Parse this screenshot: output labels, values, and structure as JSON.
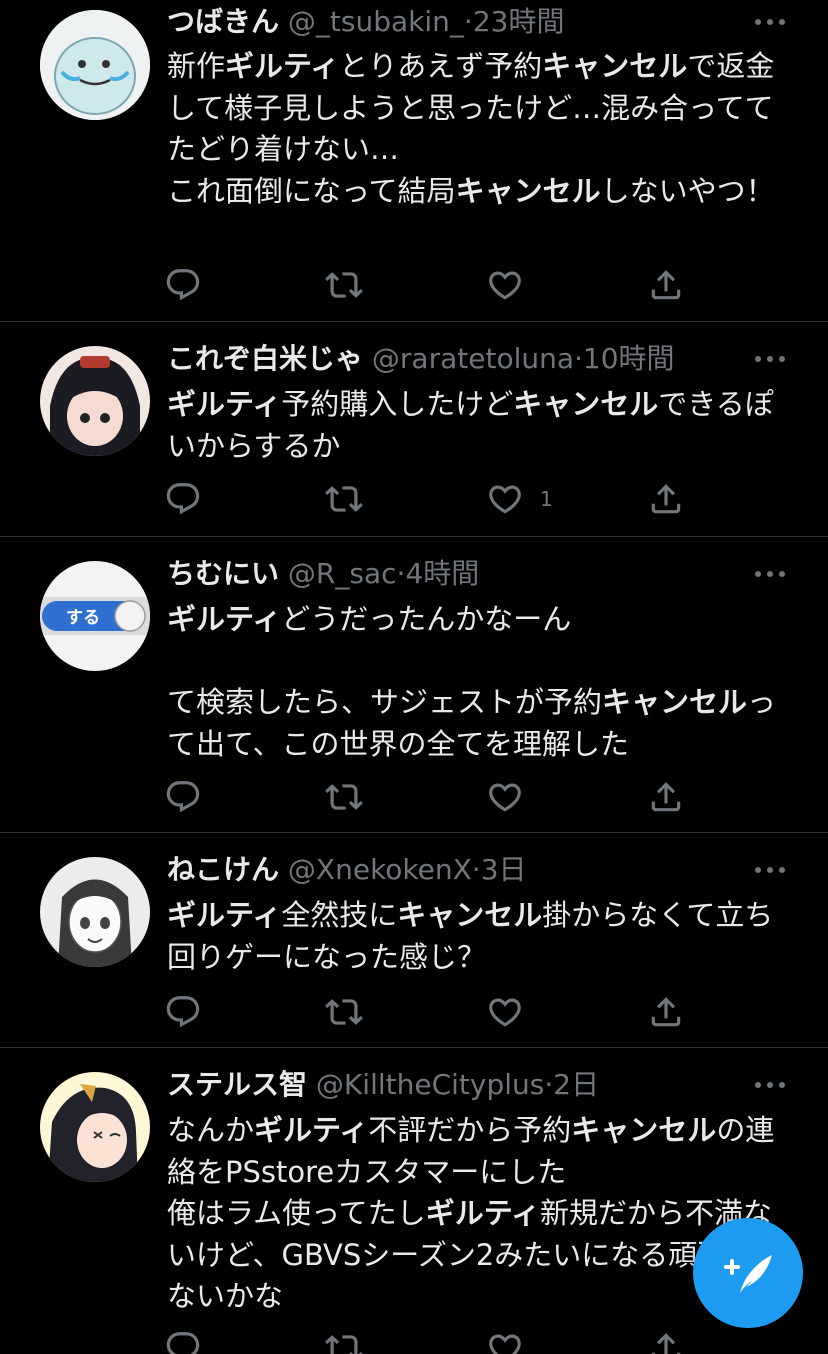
{
  "tweets": [
    {
      "name": "つばきん",
      "handle": "@_tsubakin_",
      "dot": "·",
      "time": "23時間",
      "content": "新作<b>ギルティ</b>とりあえず予約<b>キャンセル</b>で返金して様子見しようと思ったけど…混み合っててたどり着けない…\nこれ面倒になって結局<b>キャンセル</b>しないやつ！",
      "like_count": ""
    },
    {
      "name": "これぞ白米じゃ",
      "handle": "@raratetoluna",
      "dot": "·",
      "time": "10時間",
      "content": "<b>ギルティ</b>予約購入したけど<b>キャンセル</b>できるぽいからするか",
      "like_count": "1"
    },
    {
      "name": "ちむにい",
      "handle": "@R_sac",
      "dot": "·",
      "time": "4時間",
      "content": "<b>ギルティ</b>どうだったんかなーん\n\nて検索したら、サジェストが予約<b>キャンセル</b>って出て、この世界の全てを理解した",
      "like_count": "",
      "avatar_label": "する"
    },
    {
      "name": "ねこけん",
      "handle": "@XnekokenX",
      "dot": "·",
      "time": "3日",
      "content": "<b>ギルティ</b>全然技に<b>キャンセル</b>掛からなくて立ち回りゲーになった感じ？",
      "like_count": ""
    },
    {
      "name": "ステルス智",
      "handle": "@KilltheCityplus",
      "dot": "·",
      "time": "2日",
      "content": "なんか<b>ギルティ</b>不評だから予約<b>キャンセル</b>の連絡をPSstoreカスタマーにした\n俺はラム使ってたし<b>ギルティ</b>新規だから不満ないけど、GBVSシーズン2みたいになる頑張れないかな",
      "like_count": ""
    }
  ],
  "icons": {
    "reply": "reply-icon",
    "retweet": "retweet-icon",
    "like": "heart-icon",
    "share": "share-icon",
    "more": "more-icon",
    "compose": "compose-tweet-icon"
  },
  "colors": {
    "background": "#000000",
    "text": "#e7e9ea",
    "secondary": "#71767b",
    "divider": "#2f3336",
    "accent": "#1d9bf0"
  }
}
